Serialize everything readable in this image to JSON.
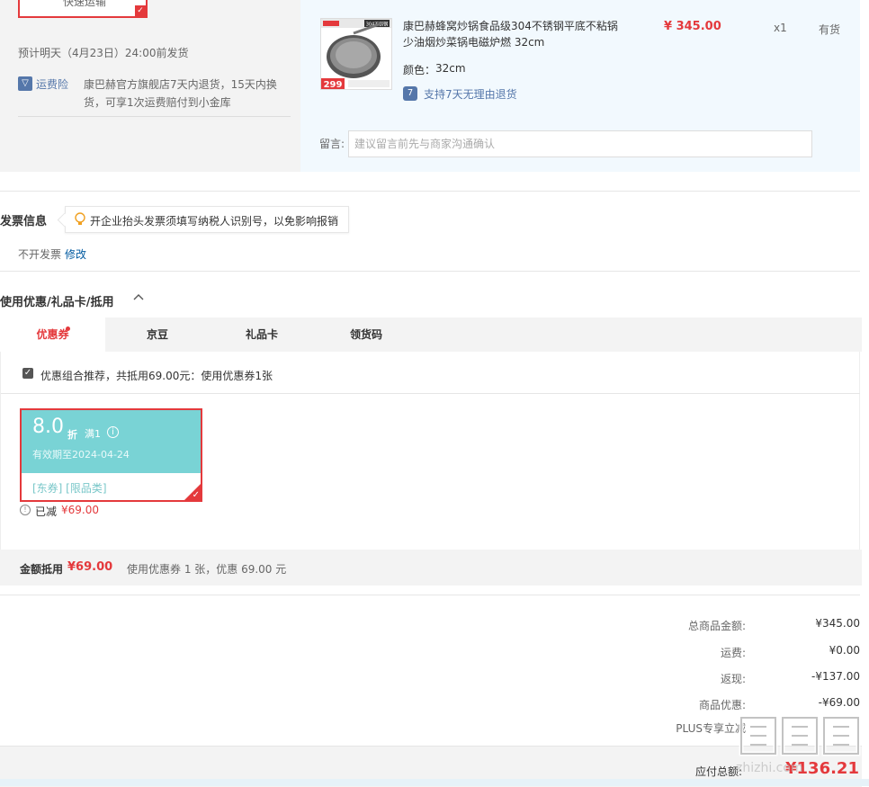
{
  "shipping": {
    "method_label": "快速运输",
    "delivery_text": "预计明天（4月23日）24:00前发货",
    "insurance_icon": "▽",
    "insurance_link": "运费险",
    "insurance_desc": "康巴赫官方旗舰店7天内退货，15天内换货，可享1次运费赔付到小金库"
  },
  "product": {
    "image_badge": "304不锈钢",
    "image_price": "299",
    "title": "康巴赫蜂窝炒锅食品级304不锈钢平底不粘锅少油烟炒菜锅电磁炉燃 32cm",
    "price": "¥ 345.00",
    "qty": "x1",
    "stock": "有货",
    "color_label": "颜色：",
    "color_value": "32cm",
    "return_icon": "7",
    "return_text": "支持7天无理由退货",
    "message_label": "留言:",
    "message_placeholder": "建议留言前先与商家沟通确认"
  },
  "invoice": {
    "title": "发票信息",
    "tip": "开企业抬头发票须填写纳税人识别号，以免影响报销",
    "status": "不开发票",
    "edit_label": "修改"
  },
  "coupons": {
    "title": "使用优惠/礼品卡/抵用",
    "tabs": [
      {
        "label": "优惠券"
      },
      {
        "label": "京豆"
      },
      {
        "label": "礼品卡"
      },
      {
        "label": "领货码"
      }
    ],
    "combo_text": "优惠组合推荐，共抵用69.00元：使用优惠券1张",
    "card": {
      "discount": "8.0",
      "unit": "折",
      "condition": "满1",
      "expire": "有效期至2024-04-24",
      "tags": "[东券]  [限品类]"
    },
    "saved_label": "已减",
    "saved_amount": "¥69.00",
    "summary_label": "金额抵用",
    "summary_amount": "¥69.00",
    "summary_desc": "使用优惠券 1 张，优惠 69.00 元"
  },
  "totals": {
    "rows": [
      {
        "label": "总商品金额:",
        "value": "¥345.00"
      },
      {
        "label": "运费:",
        "value": "¥0.00"
      },
      {
        "label": "返现:",
        "value": "-¥137.00"
      },
      {
        "label": "商品优惠:",
        "value": "-¥69.00"
      },
      {
        "label": "PLUS专享立减",
        "value": ""
      }
    ],
    "payable_label": "应付总额:",
    "payable_value": "¥136.21"
  },
  "watermark": {
    "text": "zhizhi.com",
    "glyph": "值值值"
  },
  "colors": {
    "accent_red": "#e4393c",
    "coupon_teal": "#79d3d5",
    "link_blue": "#005aa0",
    "product_bg": "#f2f9fe"
  }
}
